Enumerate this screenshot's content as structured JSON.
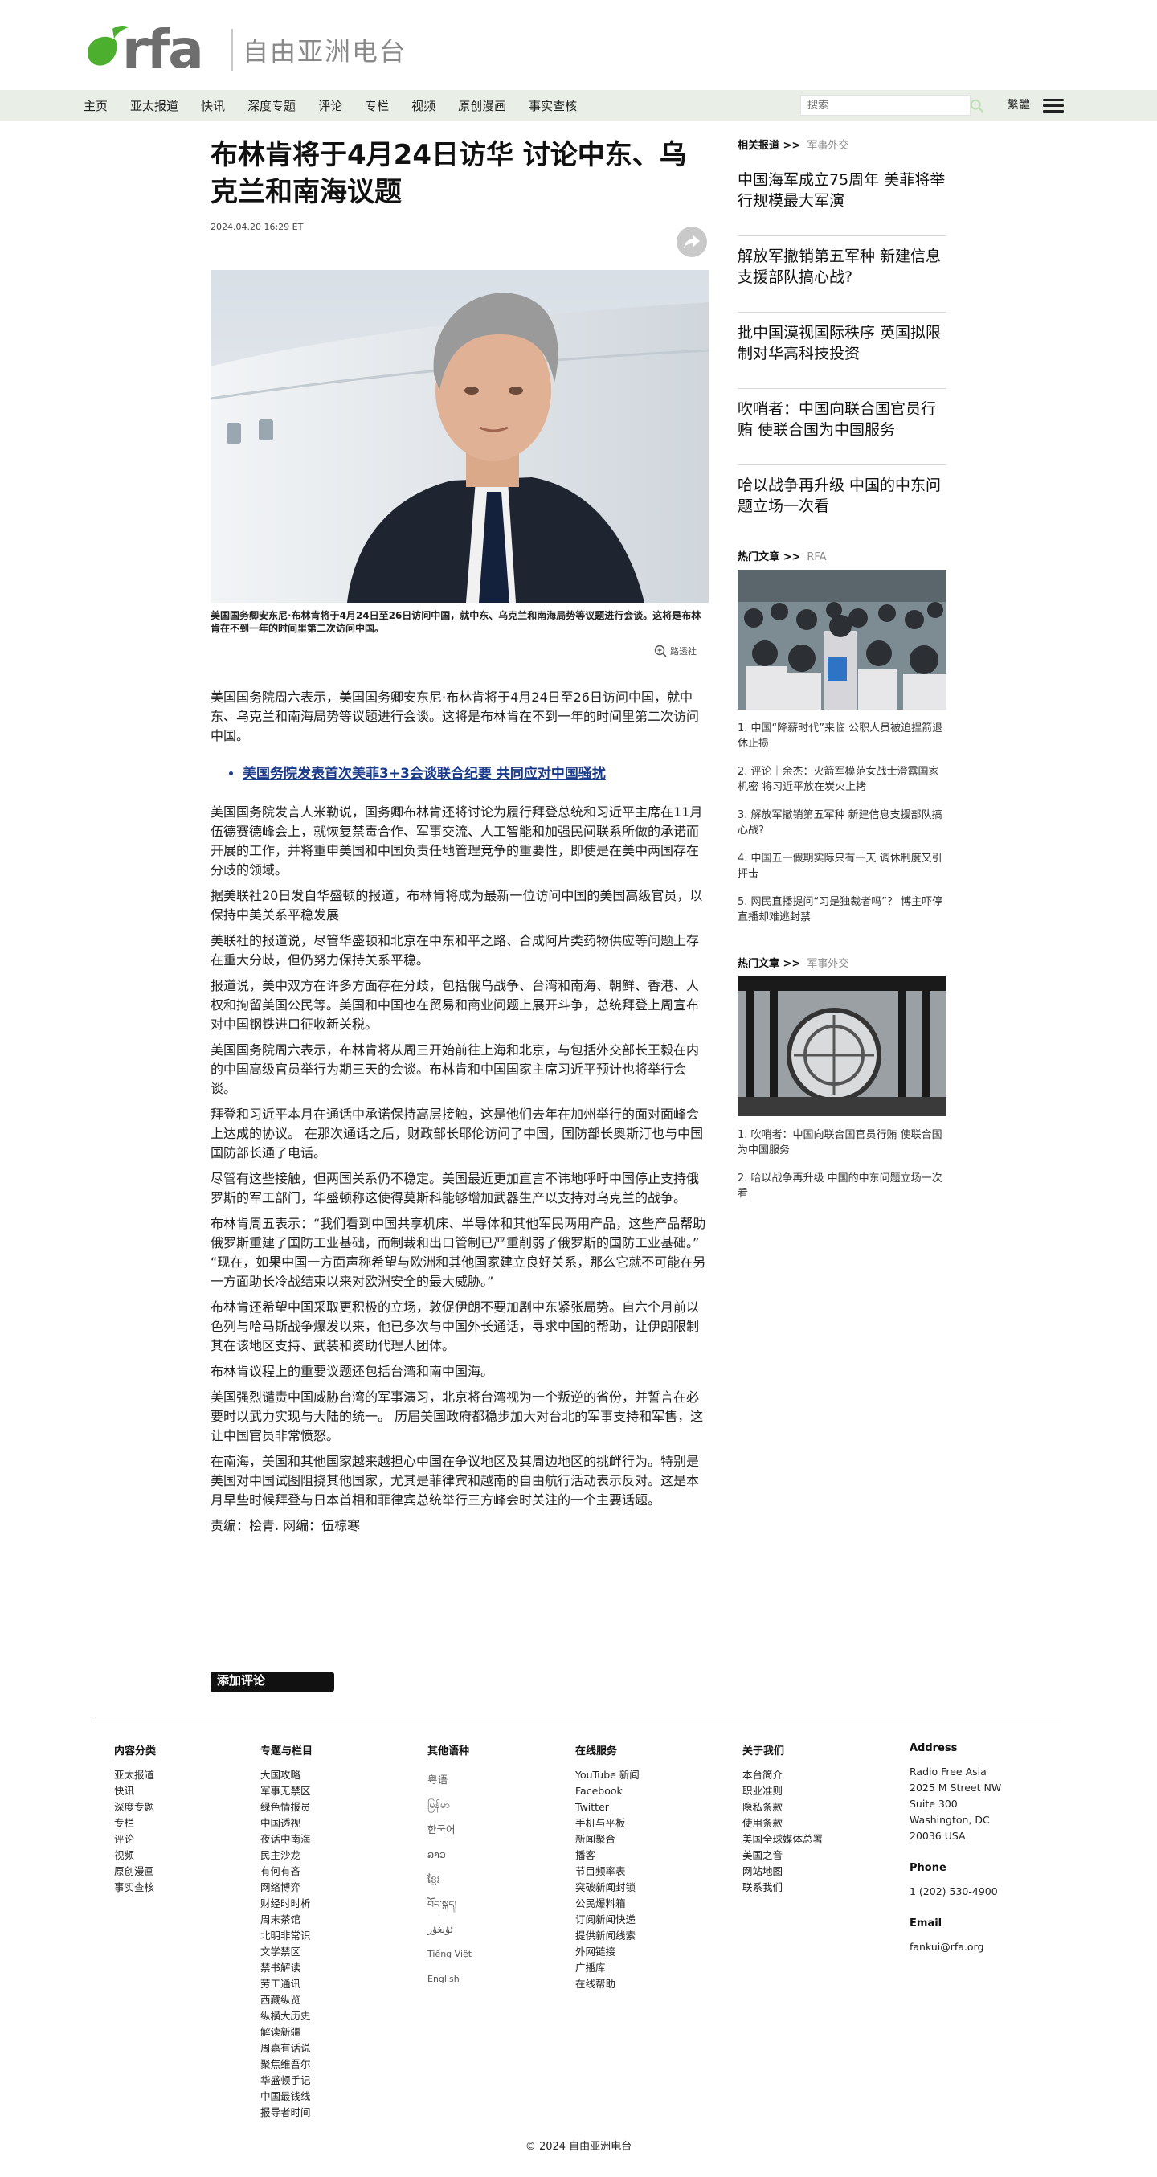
{
  "brand": {
    "logo_text": "rfa",
    "name_cn": "自由亚洲电台",
    "color": "#4caf2e"
  },
  "nav": {
    "items": [
      "主页",
      "亚太报道",
      "快讯",
      "深度专题",
      "评论",
      "专栏",
      "视频",
      "原创漫画",
      "事实查核"
    ],
    "search_placeholder": "搜索",
    "traditional_label": "繁體"
  },
  "article": {
    "title": "布林肯将于4月24日访华 讨论中东、乌克兰和南海议题",
    "date": "2024.04.20 16:29 ET",
    "photo_caption": "美国国务卿安东尼·布林肯将于4月24日至26日访问中国，就中东、乌克兰和南海局势等议题进行会谈。这将是布林肯在不到一年的时间里第二次访问中国。",
    "photo_credit": "路透社",
    "lead": "美国国务院周六表示，美国国务卿安东尼·布林肯将于4月24日至26日访问中国，就中东、乌克兰和南海局势等议题进行会谈。这将是布林肯在不到一年的时间里第二次访问中国。",
    "related_link": "美国务院发表首次美菲3+3会谈联合纪要 共同应对中国骚扰",
    "paragraphs": [
      "美国国务院发言人米勒说，国务卿布林肯还将讨论为履行拜登总统和习近平主席在11月伍德赛德峰会上，就恢复禁毒合作、军事交流、人工智能和加强民间联系所做的承诺而开展的工作，并将重申美国和中国负责任地管理竞争的重要性，即使是在美中两国存在分歧的领域。",
      "据美联社20日发自华盛顿的报道，布林肯将成为最新一位访问中国的美国高级官员，以保持中美关系平稳发展",
      "美联社的报道说，尽管华盛顿和北京在中东和平之路、合成阿片类药物供应等问题上存在重大分歧，但仍努力保持关系平稳。",
      "报道说，美中双方在许多方面存在分歧，包括俄乌战争、台湾和南海、朝鲜、香港、人权和拘留美国公民等。美国和中国也在贸易和商业问题上展开斗争，总统拜登上周宣布对中国钢铁进口征收新关税。",
      "美国国务院周六表示，布林肯将从周三开始前往上海和北京，与包括外交部长王毅在内的中国高级官员举行为期三天的会谈。布林肯和中国国家主席习近平预计也将举行会谈。",
      "拜登和习近平本月在通话中承诺保持高层接触，这是他们去年在加州举行的面对面峰会上达成的协议。 在那次通话之后，财政部长耶伦访问了中国，国防部长奥斯汀也与中国国防部长通了电话。",
      "尽管有这些接触，但两国关系仍不稳定。美国最近更加直言不讳地呼吁中国停止支持俄罗斯的军工部门，华盛顿称这使得莫斯科能够增加武器生产以支持对乌克兰的战争。",
      "布林肯周五表示：“我们看到中国共享机床、半导体和其他军民两用产品，这些产品帮助俄罗斯重建了国防工业基础，而制裁和出口管制已严重削弱了俄罗斯的国防工业基础。” “现在，如果中国一方面声称希望与欧洲和其他国家建立良好关系，那么它就不可能在另一方面助长冷战结束以来对欧洲安全的最大威胁。”",
      "布林肯还希望中国采取更积极的立场，敦促伊朗不要加剧中东紧张局势。自六个月前以色列与哈马斯战争爆发以来，他已多次与中国外长通话，寻求中国的帮助，让伊朗限制其在该地区支持、武装和资助代理人团体。",
      "布林肯议程上的重要议题还包括台湾和南中国海。",
      "美国强烈谴责中国威胁台湾的军事演习，北京将台湾视为一个叛逆的省份，并誓言在必要时以武力实现与大陆的统一。 历届美国政府都稳步加大对台北的军事支持和军售，这让中国官员非常愤怒。",
      "在南海，美国和其他国家越来越担心中国在争议地区及其周边地区的挑衅行为。特别是美国对中国试图阻挠其他国家，尤其是菲律宾和越南的自由航行活动表示反对。这是本月早些时候拜登与日本首相和菲律宾总统举行三方峰会时关注的一个主要话题。"
    ],
    "editors": "责编：桧青.     网编：伍椋寒",
    "comment_button": "添加评论"
  },
  "sidebar": {
    "related_label": "相关报道 >>",
    "related_sub": "军事外交",
    "related": [
      "中国海军成立75周年 美菲将举行规模最大军演",
      "解放军撤销第五军种  新建信息支援部队搞心战?",
      "批中国漠视国际秩序    英国拟限制对华高科技投资",
      "吹哨者：中国向联合国官员行贿    使联合国为中国服务",
      "哈以战争再升级 中国的中东问题立场一次看"
    ],
    "popular1_label": "热门文章 >>",
    "popular1_sub": "RFA",
    "popular1": [
      "1. 中国“降薪时代”来临    公职人员被迫捏箭退休止损",
      "2. 评论｜余杰：火箭军模范女战士澄露国家机密 将习近平放在炭火上拷",
      "3. 解放军撤销第五军种  新建信息支援部队搞心战?",
      "4. 中国五一假期实际只有一天 调休制度又引抨击",
      "5. 网民直播提问“习是独裁者吗”？ 博主吓停直播却难逃封禁"
    ],
    "popular2_label": "热门文章 >>",
    "popular2_sub": "军事外交",
    "popular2": [
      "1. 吹哨者：中国向联合国官员行贿    使联合国为中国服务",
      "2. 哈以战争再升级 中国的中东问题立场一次看"
    ]
  },
  "footer": {
    "col1_title": "内容分类",
    "col1": [
      "亚太报道",
      "快讯",
      "深度专题",
      "专栏",
      "评论",
      "视频",
      "原创漫画",
      "事实查核"
    ],
    "col2_title": "专题与栏目",
    "col2": [
      "大国攻略",
      "军事无禁区",
      "绿色情报员",
      "中国透视",
      "夜话中南海",
      "民主沙龙",
      "有何有吝",
      "网络博弈",
      "财经时时析",
      "周末茶馆",
      "北明非常识",
      "文学禁区",
      "禁书解读",
      "劳工通讯",
      "西藏纵览",
      "纵横大历史",
      "解读新疆",
      "周嘉有话说",
      "聚焦维吾尔",
      "华盛顿手记",
      "中国最钱线",
      "报导者时间"
    ],
    "col3_title": "其他语种",
    "col3": [
      "粤语",
      "မြန်မာ",
      "한국어",
      "ລາວ",
      "ខ្មែរ",
      "བོད་སྐད།",
      "ئۇيغۇر",
      "Tiếng Việt",
      "English"
    ],
    "col4_title": "在线服务",
    "col4": [
      "YouTube 新闻",
      "Facebook",
      "Twitter",
      "手机与平板",
      "新闻聚合",
      "播客",
      "节目频率表",
      "突破新闻封锁",
      "公民爆料箱",
      "订阅新闻快递",
      "提供新闻线索",
      "外网链接",
      "广播库",
      "在线帮助"
    ],
    "col5_title": "关于我们",
    "col5": [
      "本台简介",
      "职业准则",
      "隐私条款",
      "使用条款",
      "美国全球媒体总署",
      "美国之音",
      "网站地图",
      "联系我们"
    ],
    "address_title": "Address",
    "address_lines": [
      "Radio Free Asia",
      "2025 M Street NW",
      "Suite 300",
      "Washington, DC",
      "20036 USA"
    ],
    "phone_title": "Phone",
    "phone": "1 (202) 530-4900",
    "email_title": "Email",
    "email": "fankui@rfa.org",
    "copyright": "© 2024 自由亚洲电台"
  }
}
